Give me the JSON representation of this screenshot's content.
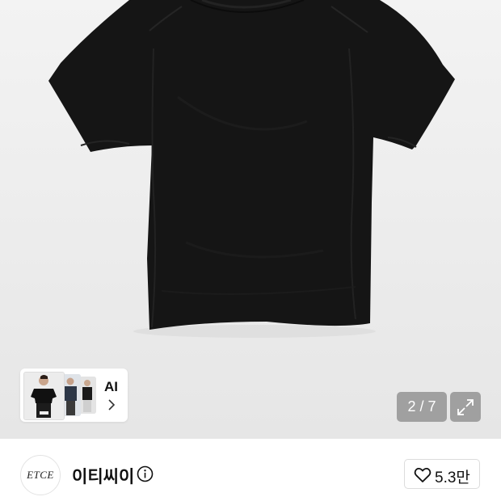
{
  "gallery": {
    "image_alt": "black short sleeve t-shirt",
    "counter": {
      "current": "2",
      "separator": " / ",
      "total": "7"
    },
    "expand_icon": "expand-icon"
  },
  "ai_card": {
    "label": "AI",
    "chevron_icon": "chevron-right-icon"
  },
  "brand": {
    "logo_text": "ETCE",
    "name": "이티씨이",
    "info_icon": "info-icon"
  },
  "like": {
    "icon": "heart-icon",
    "count": "5.3만"
  },
  "colors": {
    "shirt": "#141414",
    "counter_bg": "#8c8c8c",
    "text": "#111111"
  }
}
